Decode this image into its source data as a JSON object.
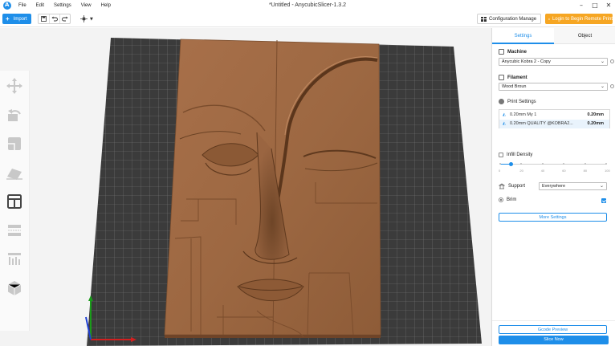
{
  "app": {
    "document_title": "*Untitled - AnycubicSlicer-1.3.2",
    "menu": [
      "File",
      "Edit",
      "Settings",
      "View",
      "Help"
    ],
    "window_controls": [
      "minimize",
      "maximize",
      "close"
    ]
  },
  "toolbar": {
    "import_label": "Import",
    "tools": [
      "save-icon",
      "undo-icon",
      "redo-icon"
    ],
    "view_icon": "view-cube-icon",
    "config_label": "Configuration Manage",
    "login_label": "Login to Begin Remote Print"
  },
  "left_tools": [
    "move-icon",
    "rotate-icon",
    "place-on-face-icon",
    "cut-icon",
    "support-paint-icon",
    "seam-paint-icon",
    "measure-icon",
    "assembly-icon"
  ],
  "panel": {
    "tabs": [
      {
        "label": "Settings",
        "active": true
      },
      {
        "label": "Object",
        "active": false
      }
    ],
    "machine": {
      "heading": "Machine",
      "value": "Anycubic Kobra 2 - Copy"
    },
    "filament": {
      "heading": "Filament",
      "value": "Wood Broun"
    },
    "print_settings": {
      "heading": "Print Settings",
      "rows": [
        {
          "label": "0.20mm My 1",
          "value": "0.20mm",
          "selected": false
        },
        {
          "label": "0.20mm QUALITY @KOBRA2...",
          "value": "0.20mm",
          "selected": true
        }
      ]
    },
    "infill": {
      "heading": "Infill Density",
      "value_percent": 10,
      "ticks": [
        "0",
        "20",
        "40",
        "60",
        "80",
        "100"
      ]
    },
    "support": {
      "heading": "Support",
      "value": "Everywhere"
    },
    "brim": {
      "heading": "Brim",
      "checked": true
    },
    "more_settings_label": "More Settings",
    "gcode_preview_label": "Gcode Preview",
    "slice_label": "Slice Now"
  },
  "colors": {
    "accent": "#1e8ee9",
    "login": "#f6a623",
    "plate_dark": "#3a3a3a",
    "wood": "#a06a45"
  }
}
